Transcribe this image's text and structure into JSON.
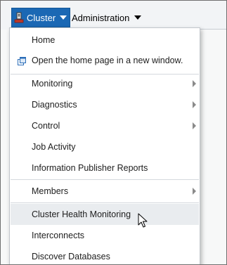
{
  "menubar": {
    "cluster_label": "Cluster",
    "administration_label": "Administration"
  },
  "dropdown": {
    "items": [
      {
        "label": "Home"
      },
      {
        "label": "Open the home page in a new window.",
        "icon": "external-window-icon"
      },
      {
        "label": "Monitoring",
        "has_submenu": true
      },
      {
        "label": "Diagnostics",
        "has_submenu": true
      },
      {
        "label": "Control",
        "has_submenu": true
      },
      {
        "label": "Job Activity"
      },
      {
        "label": "Information Publisher Reports"
      },
      {
        "label": "Members",
        "has_submenu": true
      },
      {
        "label": "Cluster Health Monitoring",
        "hovered": true
      },
      {
        "label": "Interconnects"
      },
      {
        "label": "Discover Databases"
      }
    ]
  },
  "colors": {
    "accent": "#1b68b4",
    "menubar_bg": "#f2f4f6",
    "hover_bg": "#e9ecef"
  }
}
